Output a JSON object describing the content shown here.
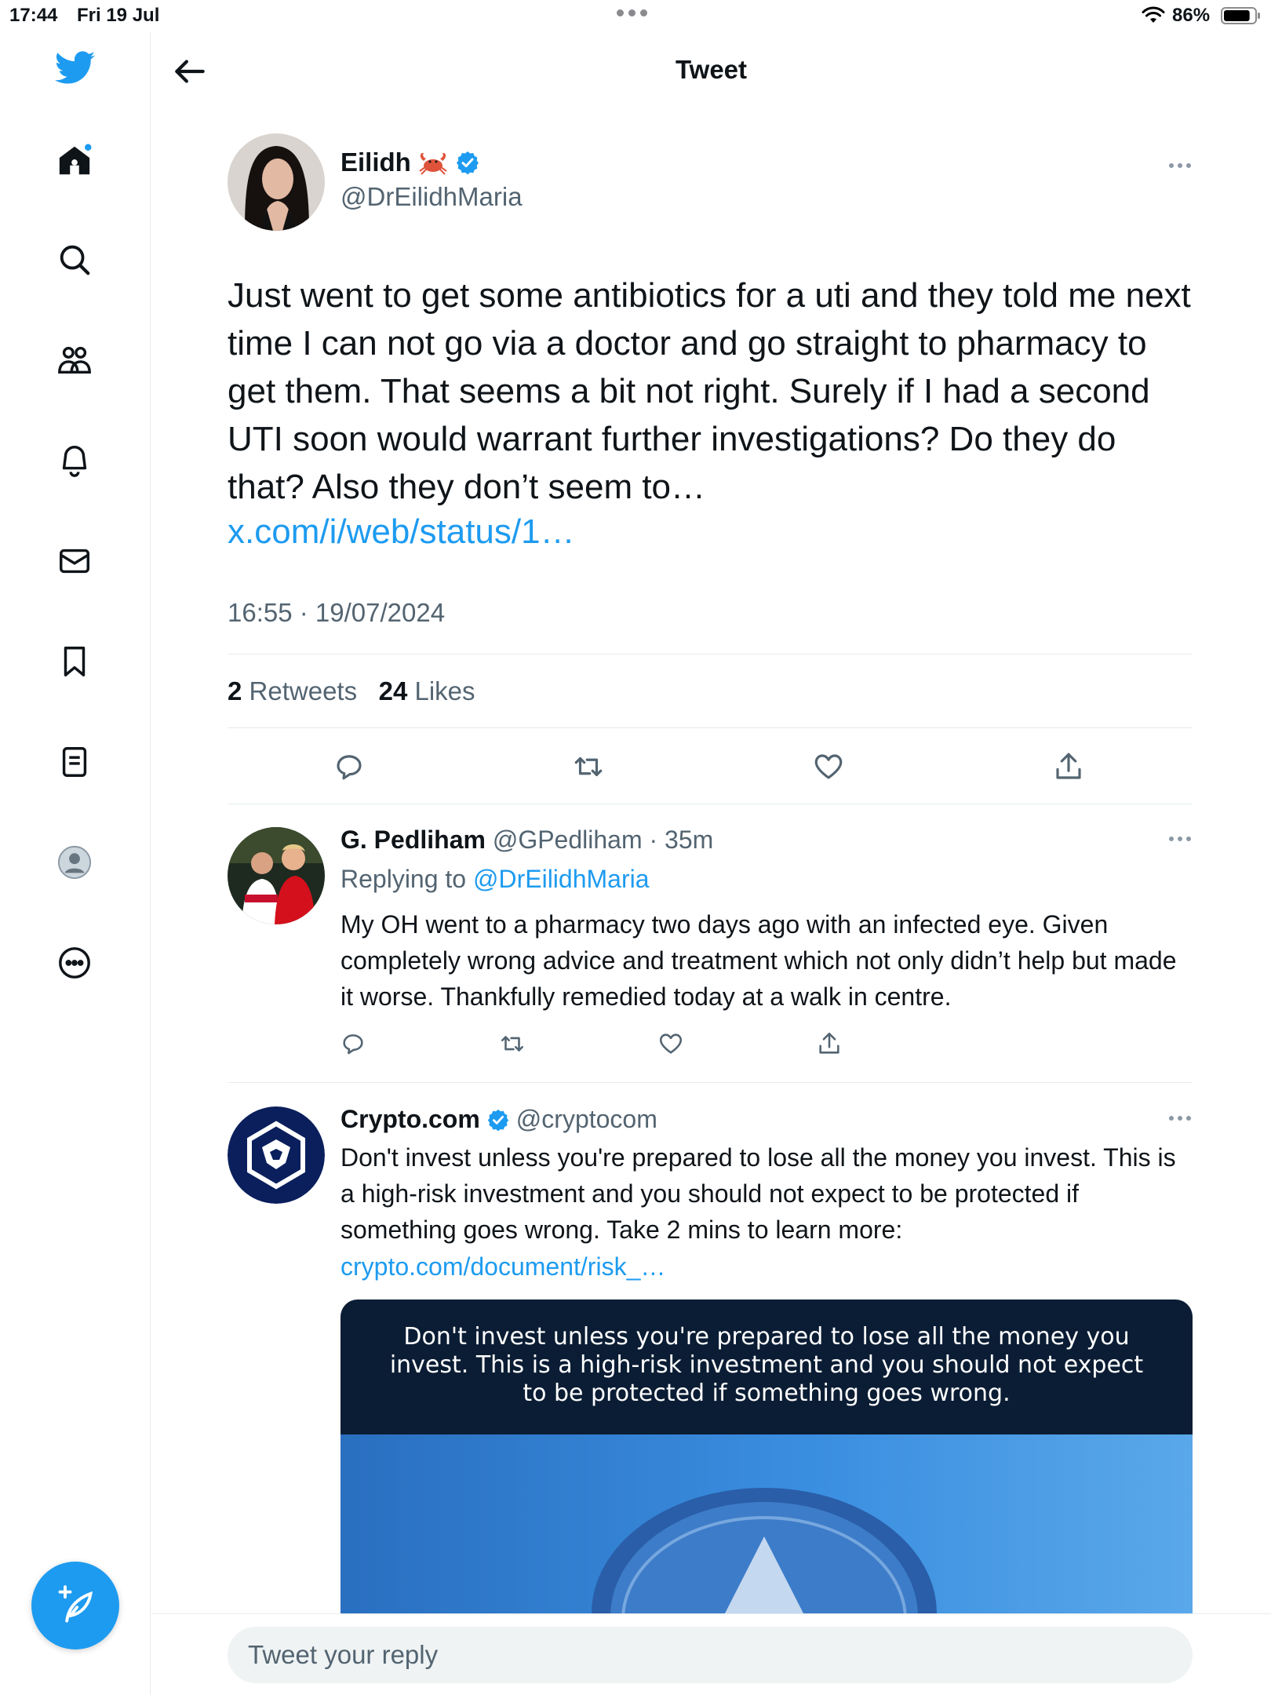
{
  "status_bar": {
    "time": "17:44",
    "date": "Fri 19 Jul",
    "battery_percent": "86%",
    "battery_level": 0.86
  },
  "sidebar": {
    "items": [
      {
        "icon": "home-icon"
      },
      {
        "icon": "search-icon"
      },
      {
        "icon": "communities-icon"
      },
      {
        "icon": "notifications-icon"
      },
      {
        "icon": "messages-icon"
      },
      {
        "icon": "bookmarks-icon"
      },
      {
        "icon": "lists-icon"
      },
      {
        "icon": "profile-icon"
      },
      {
        "icon": "more-icon"
      }
    ],
    "compose_icon": "compose-tweet-icon"
  },
  "header": {
    "title": "Tweet"
  },
  "main_tweet": {
    "display_name": "Eilidh",
    "name_emoji": "crab",
    "handle": "@DrEilidhMaria",
    "text": "Just went to get some antibiotics for a uti and they told me next time I can not go via a doctor and go straight to pharmacy to get them. That seems a bit not right. Surely if I had a second UTI soon would warrant further investigations? Do they do that? Also they don’t seem to…",
    "link": "x.com/i/web/status/1…",
    "timestamp": "16:55 · 19/07/2024",
    "retweets_count": "2",
    "retweets_label": "Retweets",
    "likes_count": "24",
    "likes_label": "Likes"
  },
  "replies": [
    {
      "display_name": "G. Pedliham",
      "handle": "@GPedliham",
      "time": "· 35m",
      "replying_to_label": "Replying to",
      "replying_to_handle": "@DrEilidhMaria",
      "text": "My OH went to a pharmacy two days ago with an infected eye. Given completely wrong advice and treatment which not only didn’t help but made it worse. Thankfully remedied today at a walk in centre."
    },
    {
      "display_name": "Crypto.com",
      "handle": "@cryptocom",
      "text": "Don't invest unless you're prepared to lose all the money you invest. This is a high-risk investment and you should not expect to be protected if something goes wrong. Take 2 mins to learn more:",
      "link": "crypto.com/document/risk_…",
      "card_text": "Don't invest unless you're prepared to lose all the money you invest. This is a high-risk investment and you should not expect to be protected if something goes wrong."
    }
  ],
  "reply_bar": {
    "placeholder": "Tweet your reply"
  },
  "colors": {
    "accent": "#1d9bf0",
    "text": "#0f1419",
    "muted": "#536471",
    "divider": "#e6ecf0"
  }
}
